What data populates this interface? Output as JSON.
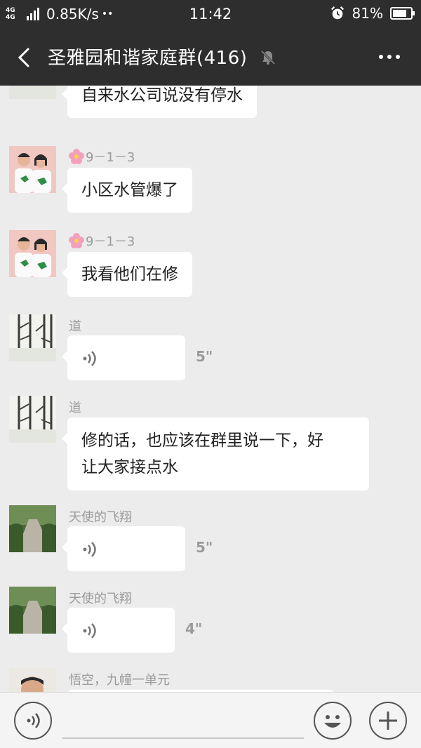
{
  "status_bar": {
    "network": "4G 4G",
    "speed": "0.85K/s",
    "dots": "••",
    "time": "11:42",
    "battery": "81%",
    "battery_level": 0.81
  },
  "header": {
    "title": "圣雅园和谐家庭群(416)"
  },
  "messages": [
    {
      "sender": "",
      "type": "text",
      "text": "自来水公司说没有停水"
    },
    {
      "sender": "9－1－3",
      "type": "text",
      "text": "小区水管爆了"
    },
    {
      "sender": "9－1－3",
      "type": "text",
      "text": "我看他们在修"
    },
    {
      "sender": "道",
      "type": "voice",
      "duration": "5\""
    },
    {
      "sender": "道",
      "type": "text",
      "lines": [
        "修的话，也应该在群里说一下，好",
        "让大家接点水"
      ]
    },
    {
      "sender": "天使的飞翔",
      "type": "voice",
      "duration": "5\""
    },
    {
      "sender": "天使的飞翔",
      "type": "voice",
      "duration": "4\""
    },
    {
      "sender": "悟空，九幢一单元",
      "type": "text",
      "text": ""
    }
  ],
  "colors": {
    "header_bg": "#2e2e2e",
    "chat_bg": "#ececec",
    "bubble_bg": "#ffffff",
    "sender_text": "#9b9b9b"
  }
}
